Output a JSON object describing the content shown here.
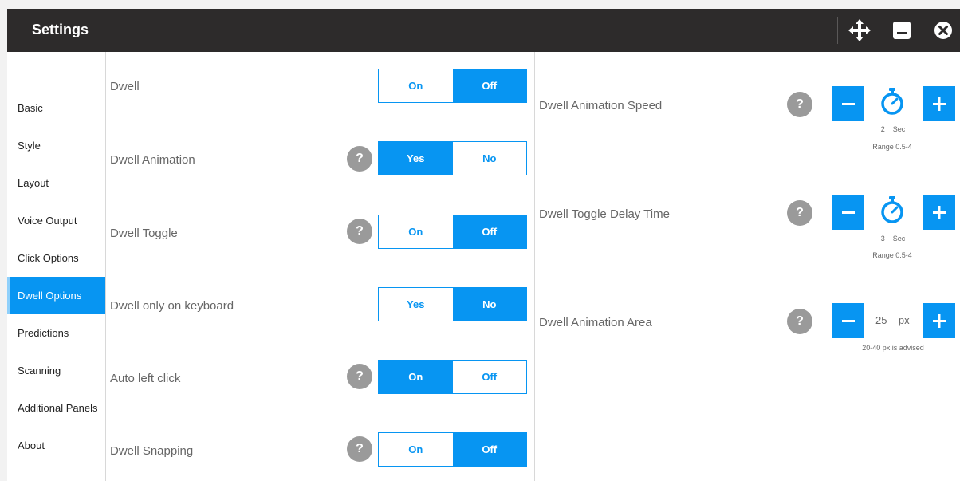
{
  "window": {
    "title": "Settings",
    "icons": [
      "move-icon",
      "minimize-icon",
      "close-icon"
    ]
  },
  "sidebar": {
    "items": [
      {
        "label": "Basic"
      },
      {
        "label": "Style"
      },
      {
        "label": "Layout"
      },
      {
        "label": "Voice Output"
      },
      {
        "label": "Click Options"
      },
      {
        "label": "Dwell Options",
        "active": true
      },
      {
        "label": "Predictions"
      },
      {
        "label": "Scanning"
      },
      {
        "label": "Additional Panels"
      },
      {
        "label": "About"
      }
    ]
  },
  "settings": [
    {
      "label": "Dwell",
      "help": false,
      "options": [
        "On",
        "Off"
      ],
      "selected": "Off"
    },
    {
      "label": "Dwell Animation",
      "help": true,
      "options": [
        "Yes",
        "No"
      ],
      "selected": "Yes"
    },
    {
      "label": "Dwell Toggle",
      "help": true,
      "options": [
        "On",
        "Off"
      ],
      "selected": "Off"
    },
    {
      "label": "Dwell only on keyboard",
      "help": false,
      "options": [
        "Yes",
        "No"
      ],
      "selected": "No"
    },
    {
      "label": "Auto left click",
      "help": true,
      "options": [
        "On",
        "Off"
      ],
      "selected": "On"
    },
    {
      "label": "Dwell Snapping",
      "help": true,
      "options": [
        "On",
        "Off"
      ],
      "selected": "Off"
    }
  ],
  "steppers": [
    {
      "label": "Dwell Animation Speed",
      "value": "2",
      "unit": "Sec",
      "range": "Range 0.5-4"
    },
    {
      "label": "Dwell Toggle Delay Time",
      "value": "3",
      "unit": "Sec",
      "range": "Range 0.5-4"
    },
    {
      "label": "Dwell Animation Area",
      "value": "25",
      "unit": "px",
      "range": "20-40 px is advised"
    }
  ],
  "help_glyph": "?",
  "colors": {
    "accent": "#0795f2",
    "titlebar": "#2d2b2b",
    "help": "#9a9a9a"
  }
}
